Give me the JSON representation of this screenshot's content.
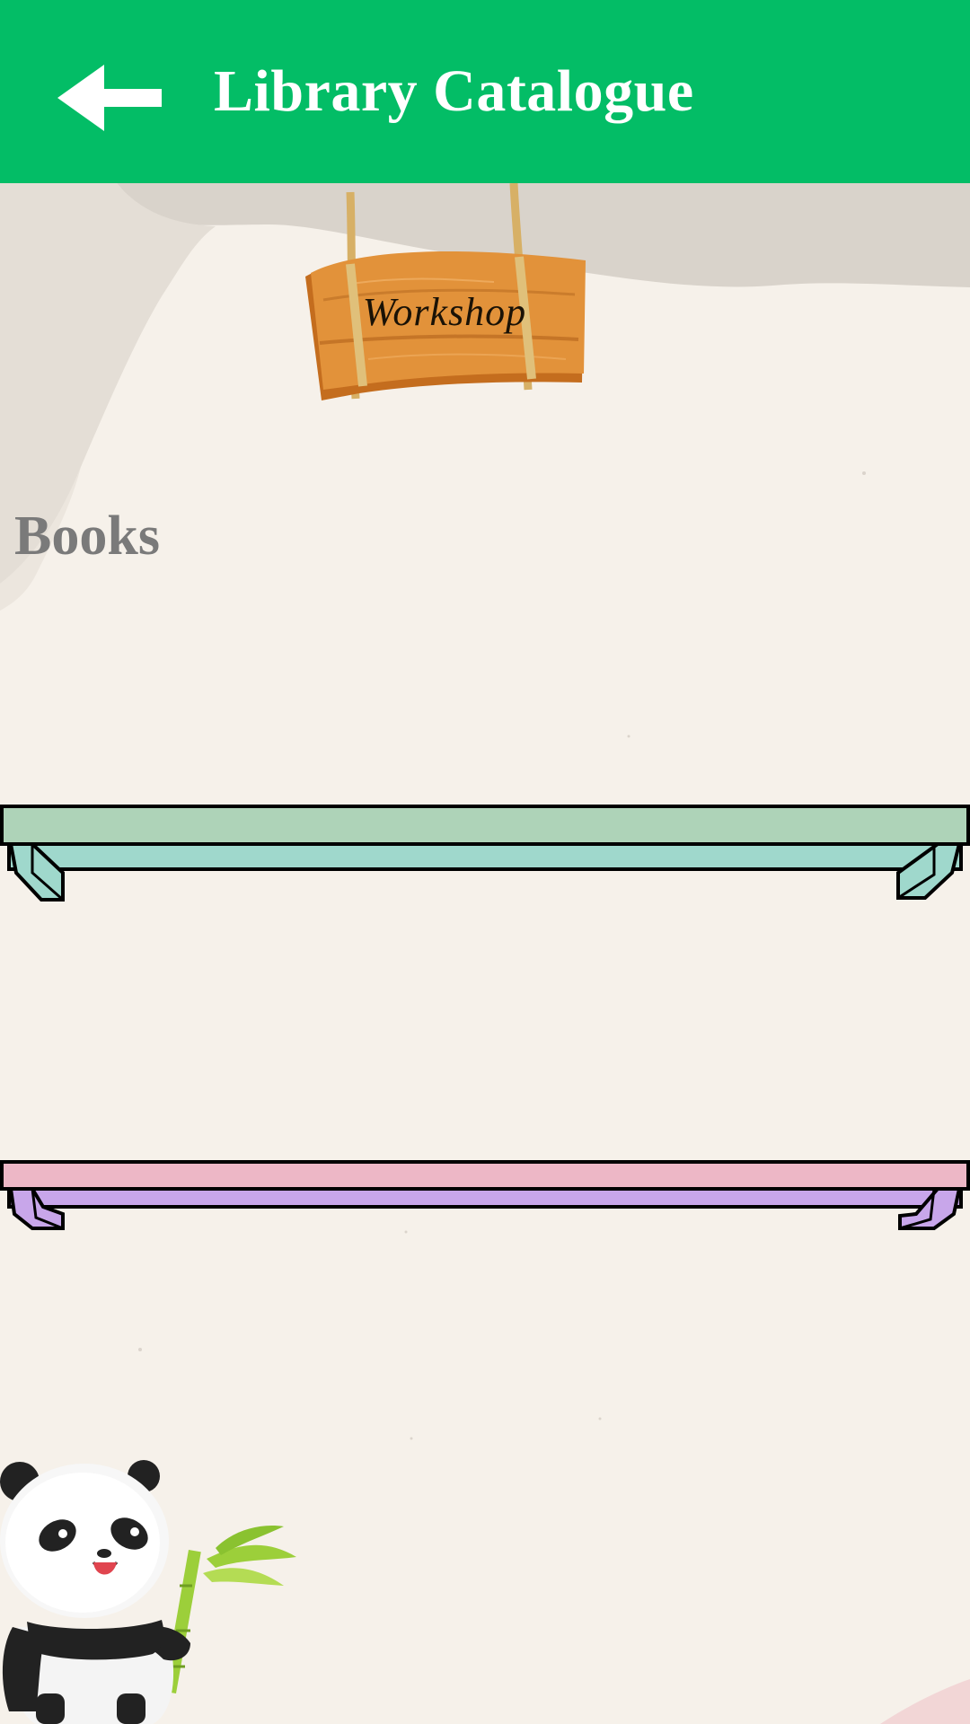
{
  "appbar": {
    "title": "Library Catalogue",
    "back_icon": "arrow-left-icon",
    "color": "#03bd66"
  },
  "sign": {
    "label": "Workshop"
  },
  "section": {
    "title": "Books"
  },
  "shelves": [
    {
      "top_color": "#aed3b8",
      "front_color": "#9fd8cc"
    },
    {
      "top_color": "#edb7c6",
      "front_color": "#c8a6ea"
    }
  ],
  "decor": {
    "mascot": "panda-with-bamboo"
  }
}
